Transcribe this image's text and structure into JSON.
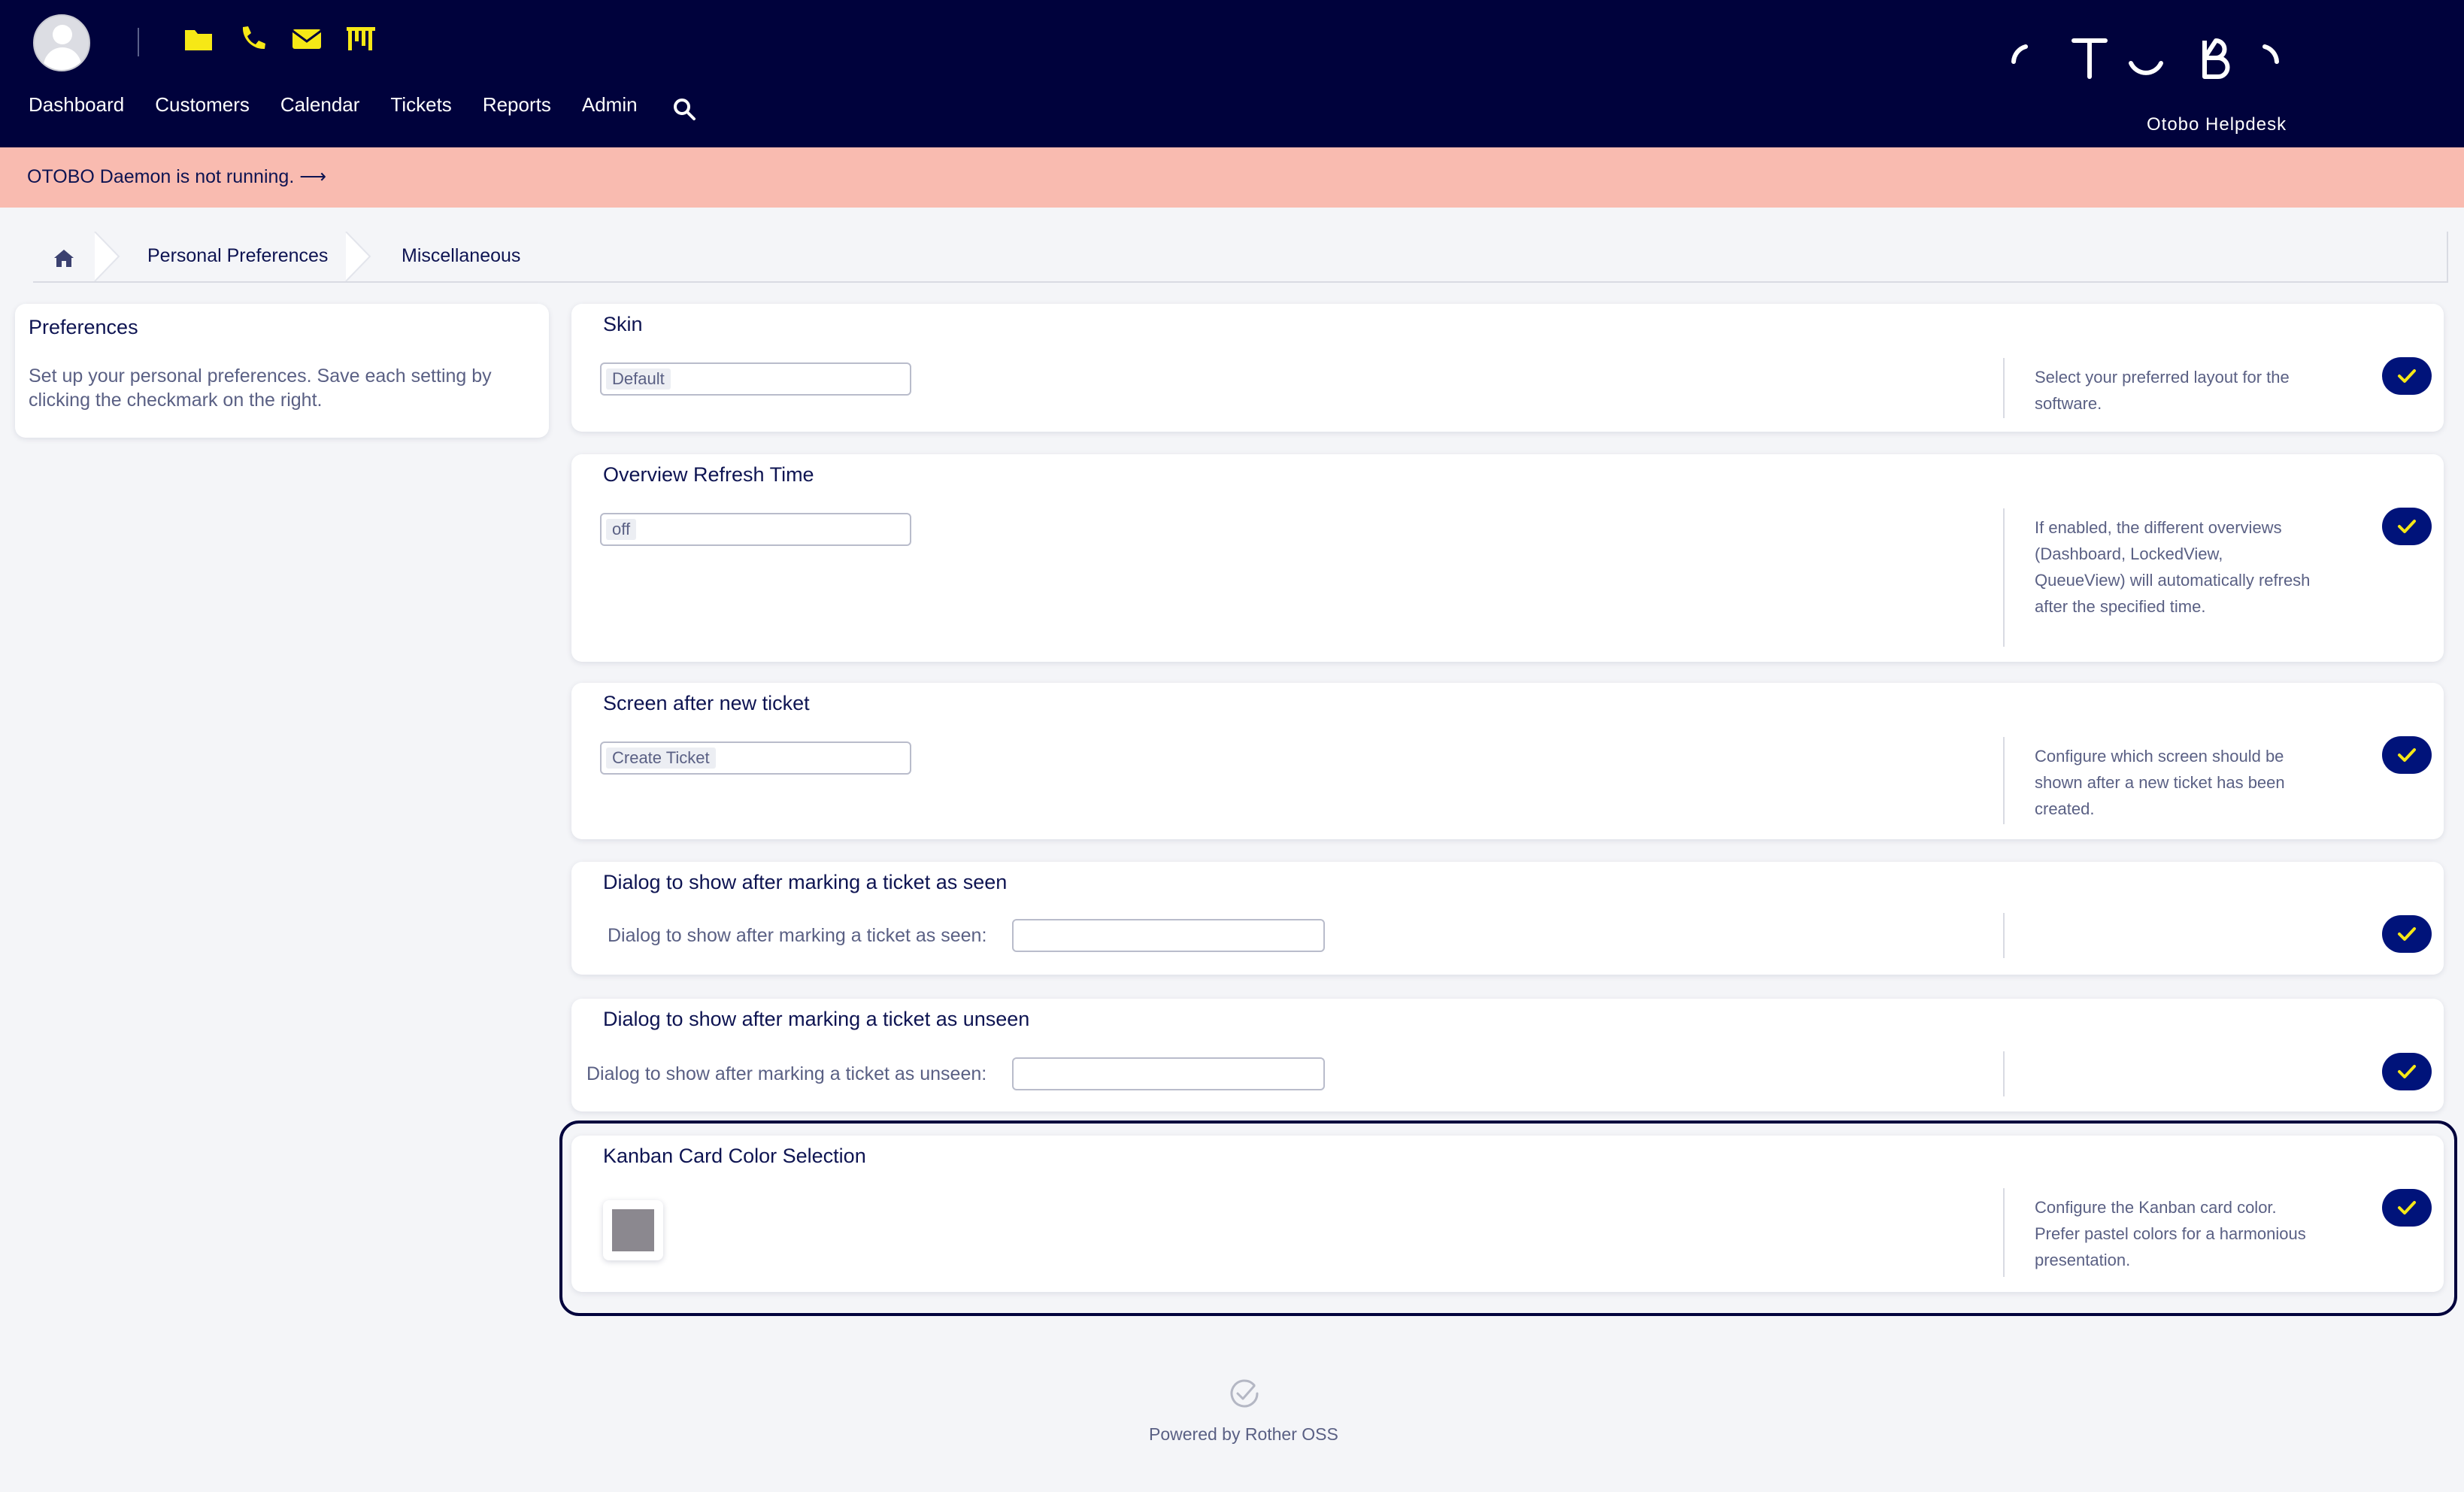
{
  "header": {
    "nav": [
      "Dashboard",
      "Customers",
      "Calendar",
      "Tickets",
      "Reports",
      "Admin"
    ],
    "icons": [
      "avatar",
      "folder-icon",
      "phone-icon",
      "email-icon",
      "kanban-icon",
      "search-icon"
    ],
    "brand": "Otobo Helpdesk",
    "accent_color": "#f6e816",
    "bg_color": "#00023c"
  },
  "banner": {
    "text": "OTOBO Daemon is not running. ⟶",
    "bg_color": "#f9bbb0"
  },
  "breadcrumb": {
    "items": [
      "Personal Preferences",
      "Miscellaneous"
    ]
  },
  "sidebar": {
    "title": "Preferences",
    "text": "Set up your personal preferences. Save each setting by clicking the checkmark on the right."
  },
  "settings": [
    {
      "title": "Skin",
      "value": "Default",
      "description": "Select your preferred layout for the software."
    },
    {
      "title": "Overview Refresh Time",
      "value": "off",
      "description": "If enabled, the different overviews (Dashboard, LockedView, QueueView) will automatically refresh after the specified time."
    },
    {
      "title": "Screen after new ticket",
      "value": "Create Ticket",
      "description": "Configure which screen should be shown after a new ticket has been created."
    },
    {
      "title": "Dialog to show after marking a ticket as seen",
      "label": "Dialog to show after marking a ticket as seen:",
      "value": ""
    },
    {
      "title": "Dialog to show after marking a ticket as unseen",
      "label": "Dialog to show after marking a ticket as unseen:",
      "value": ""
    },
    {
      "title": "Kanban Card Color Selection",
      "color": "#8b888f",
      "description": "Configure the Kanban card color. Prefer pastel colors for a harmonious presentation."
    }
  ],
  "footer": {
    "text": "Powered by Rother OSS"
  }
}
